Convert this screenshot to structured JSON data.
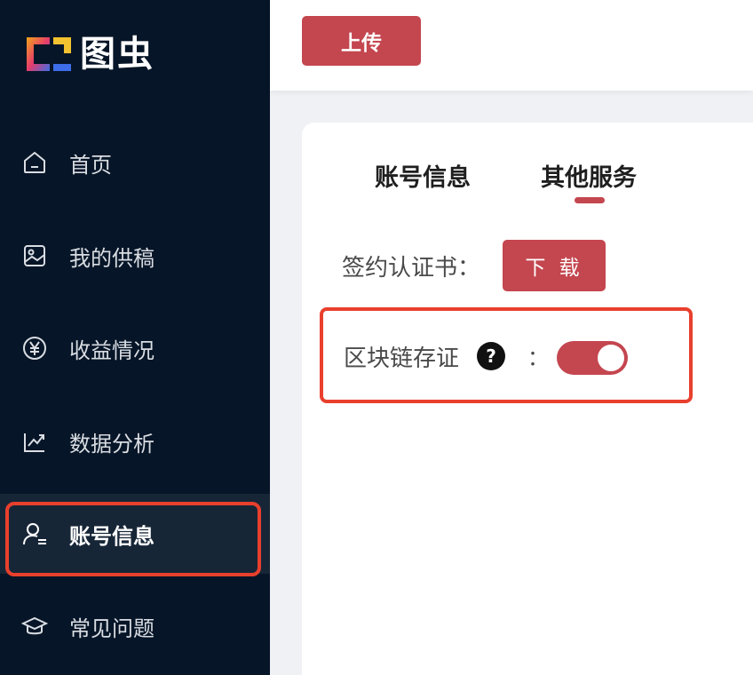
{
  "brand": {
    "name": "图虫"
  },
  "sidebar": {
    "items": [
      {
        "label": "首页",
        "icon": "home-icon"
      },
      {
        "label": "我的供稿",
        "icon": "image-icon"
      },
      {
        "label": "收益情况",
        "icon": "yen-icon"
      },
      {
        "label": "数据分析",
        "icon": "chart-icon"
      },
      {
        "label": "账号信息",
        "icon": "user-icon",
        "active": true
      },
      {
        "label": "常见问题",
        "icon": "graduation-cap-icon"
      }
    ]
  },
  "header": {
    "upload_label": "上传"
  },
  "tabs": [
    {
      "label": "账号信息"
    },
    {
      "label": "其他服务",
      "active": true
    }
  ],
  "services": {
    "certificate_label": "签约认证书：",
    "download_label": "下 载",
    "blockchain_label": "区块链存证",
    "help_symbol": "?",
    "colon": "：",
    "blockchain_enabled": true
  },
  "colors": {
    "accent": "#c4464f",
    "sidebar_bg": "#061527",
    "sidebar_active_bg": "#172637",
    "highlight": "#e8402d"
  }
}
